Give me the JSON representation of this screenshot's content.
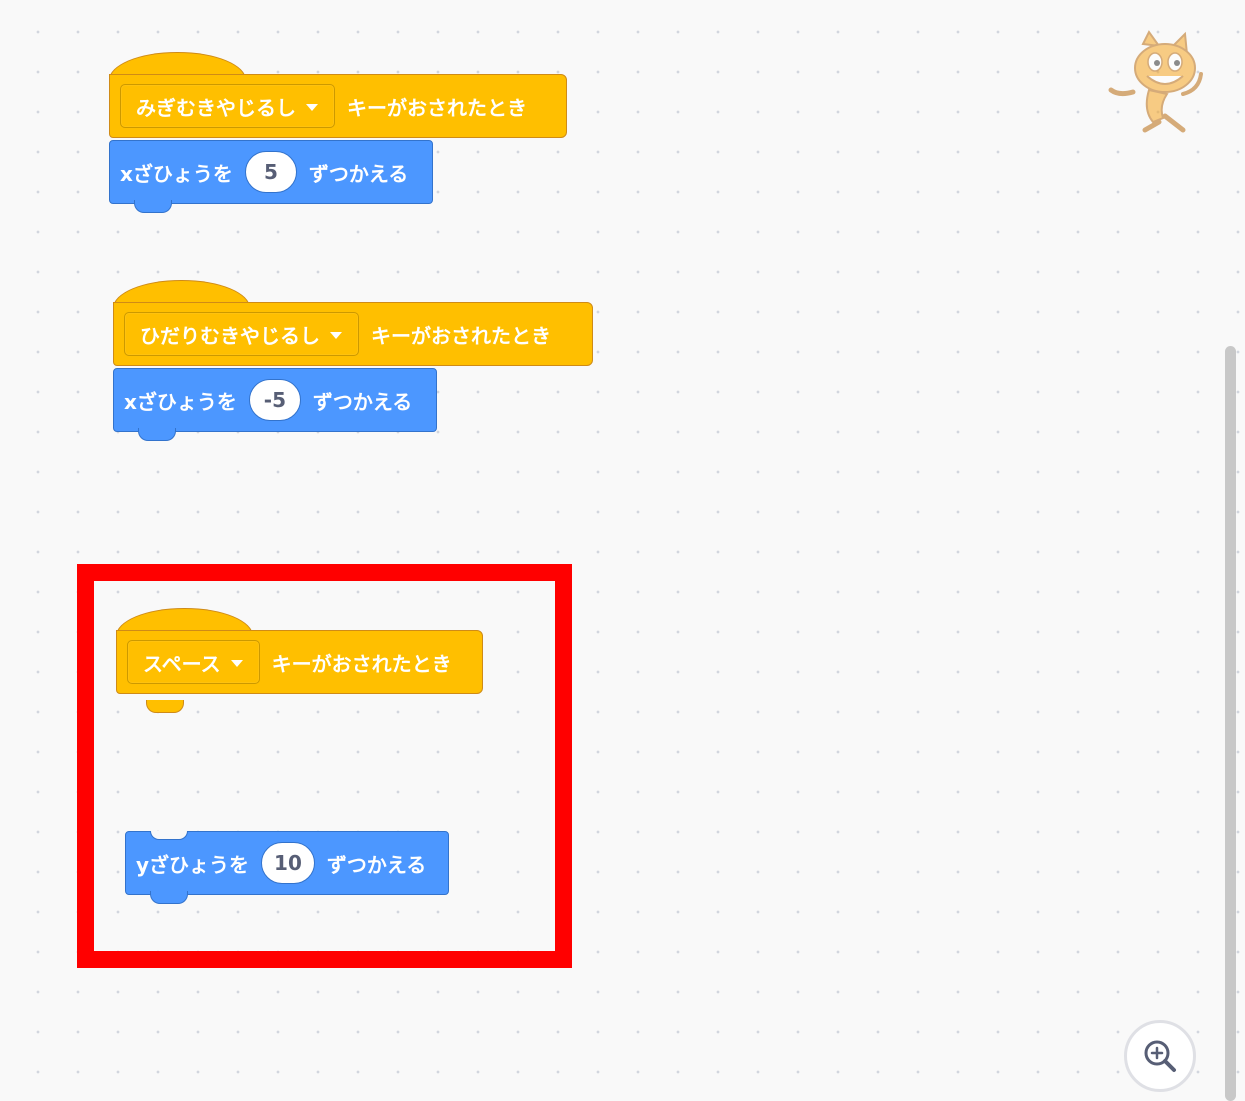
{
  "scripts": [
    {
      "hat": {
        "key_option": "みぎむきやじるし",
        "event_label": "キーがおされたとき"
      },
      "motion": {
        "prefix": "xざひょうを",
        "value": "5",
        "suffix": "ずつかえる"
      }
    },
    {
      "hat": {
        "key_option": "ひだりむきやじるし",
        "event_label": "キーがおされたとき"
      },
      "motion": {
        "prefix": "xざひょうを",
        "value": "-5",
        "suffix": "ずつかえる"
      }
    },
    {
      "hat": {
        "key_option": "スペース",
        "event_label": "キーがおされたとき"
      },
      "motion": {
        "prefix": "yざひょうを",
        "value": "10",
        "suffix": "ずつかえる"
      }
    }
  ],
  "colors": {
    "events_block": "#ffbf00",
    "motion_block": "#4c97ff",
    "highlight": "#ff0000",
    "workspace_bg": "#f9f9f9"
  },
  "icons": {
    "sprite": "scratch-cat-sprite-icon",
    "zoom_in": "zoom-in-icon"
  }
}
